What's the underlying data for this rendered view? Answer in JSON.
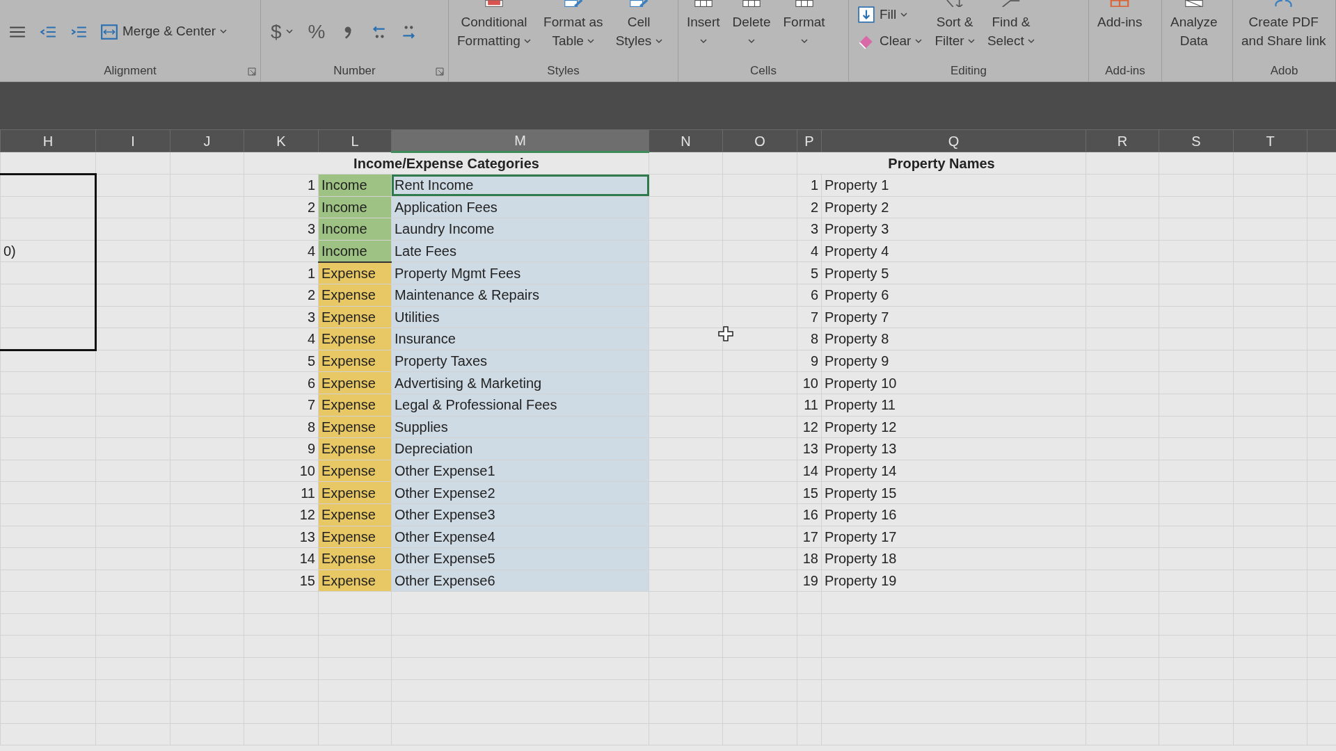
{
  "ribbon": {
    "groups": [
      {
        "label": "Alignment",
        "launcher": true,
        "items": [
          {
            "kind": "icon"
          },
          {
            "kind": "icon"
          },
          {
            "kind": "icon"
          },
          {
            "kind": "small",
            "label": "Merge & Center",
            "dropdown": true
          }
        ]
      },
      {
        "label": "Number",
        "launcher": true,
        "items": [
          {
            "kind": "symbol",
            "label": "$",
            "dropdown": true
          },
          {
            "kind": "symbol",
            "label": "%"
          },
          {
            "kind": "icon"
          },
          {
            "kind": "icon"
          },
          {
            "kind": "icon"
          }
        ]
      },
      {
        "label": "Styles",
        "items": [
          {
            "kind": "large",
            "lines": [
              "Conditional",
              "Formatting"
            ],
            "dropdown": true
          },
          {
            "kind": "large",
            "lines": [
              "Format as",
              "Table"
            ],
            "dropdown": true
          },
          {
            "kind": "large",
            "lines": [
              "Cell",
              "Styles"
            ],
            "dropdown": true
          }
        ]
      },
      {
        "label": "Cells",
        "items": [
          {
            "kind": "large",
            "lines": [
              "Insert"
            ],
            "dropdown": true
          },
          {
            "kind": "large",
            "lines": [
              "Delete"
            ],
            "dropdown": true
          },
          {
            "kind": "large",
            "lines": [
              "Format"
            ],
            "dropdown": true
          }
        ]
      },
      {
        "label": "Editing",
        "items": [
          {
            "kind": "stack",
            "items": [
              {
                "kind": "small",
                "label": "Fill",
                "dropdown": true
              },
              {
                "kind": "small",
                "label": "Clear",
                "dropdown": true
              }
            ]
          },
          {
            "kind": "large",
            "lines": [
              "Sort &",
              "Filter"
            ],
            "dropdown": true
          },
          {
            "kind": "large",
            "lines": [
              "Find &",
              "Select"
            ],
            "dropdown": true
          }
        ]
      },
      {
        "label": "Add-ins",
        "items": [
          {
            "kind": "large",
            "lines": [
              "Add-ins"
            ]
          }
        ]
      },
      {
        "items": [
          {
            "kind": "large",
            "lines": [
              "Analyze",
              "Data"
            ]
          }
        ]
      },
      {
        "label": "Adob",
        "items": [
          {
            "kind": "large",
            "lines": [
              "Create PDF",
              "and Share link"
            ]
          }
        ]
      }
    ]
  },
  "columns": [
    {
      "label": "H",
      "selected": false
    },
    {
      "label": "I",
      "selected": false
    },
    {
      "label": "J",
      "selected": false
    },
    {
      "label": "K",
      "selected": false
    },
    {
      "label": "L",
      "selected": false
    },
    {
      "label": "M",
      "selected": true
    },
    {
      "label": "N",
      "selected": false
    },
    {
      "label": "O",
      "selected": false
    },
    {
      "label": "P",
      "selected": false
    },
    {
      "label": "Q",
      "selected": false
    },
    {
      "label": "R",
      "selected": false
    },
    {
      "label": "S",
      "selected": false
    },
    {
      "label": "T",
      "selected": false
    }
  ],
  "categories": {
    "title": "Income/Expense Categories",
    "rows": [
      {
        "number": "1",
        "kind": "income",
        "type": "Income",
        "name": "Rent Income",
        "selected": true
      },
      {
        "number": "2",
        "kind": "income",
        "type": "Income",
        "name": "Application Fees",
        "selected": false
      },
      {
        "number": "3",
        "kind": "income",
        "type": "Income",
        "name": "Laundry Income",
        "selected": false
      },
      {
        "number": "4",
        "kind": "income",
        "type": "Income",
        "name": "Late Fees",
        "selected": false
      },
      {
        "number": "1",
        "kind": "expense",
        "type": "Expense",
        "name": "Property Mgmt Fees",
        "selected": false
      },
      {
        "number": "2",
        "kind": "expense",
        "type": "Expense",
        "name": "Maintenance & Repairs",
        "selected": false
      },
      {
        "number": "3",
        "kind": "expense",
        "type": "Expense",
        "name": "Utilities",
        "selected": false
      },
      {
        "number": "4",
        "kind": "expense",
        "type": "Expense",
        "name": "Insurance",
        "selected": false
      },
      {
        "number": "5",
        "kind": "expense",
        "type": "Expense",
        "name": "Property Taxes",
        "selected": false
      },
      {
        "number": "6",
        "kind": "expense",
        "type": "Expense",
        "name": "Advertising & Marketing",
        "selected": false
      },
      {
        "number": "7",
        "kind": "expense",
        "type": "Expense",
        "name": "Legal & Professional Fees",
        "selected": false
      },
      {
        "number": "8",
        "kind": "expense",
        "type": "Expense",
        "name": "Supplies",
        "selected": false
      },
      {
        "number": "9",
        "kind": "expense",
        "type": "Expense",
        "name": "Depreciation",
        "selected": false
      },
      {
        "number": "10",
        "kind": "expense",
        "type": "Expense",
        "name": "Other Expense1",
        "selected": false
      },
      {
        "number": "11",
        "kind": "expense",
        "type": "Expense",
        "name": "Other Expense2",
        "selected": false
      },
      {
        "number": "12",
        "kind": "expense",
        "type": "Expense",
        "name": "Other Expense3",
        "selected": false
      },
      {
        "number": "13",
        "kind": "expense",
        "type": "Expense",
        "name": "Other Expense4",
        "selected": false
      },
      {
        "number": "14",
        "kind": "expense",
        "type": "Expense",
        "name": "Other Expense5",
        "selected": false
      },
      {
        "number": "15",
        "kind": "expense",
        "type": "Expense",
        "name": "Other Expense6",
        "selected": false
      }
    ]
  },
  "left_box": {
    "rows": [
      {
        "boxed": true
      },
      {
        "boxed": true
      },
      {
        "boxed": true
      },
      {
        "boxed": true,
        "text": "0)"
      },
      {
        "boxed": true
      },
      {
        "boxed": true
      },
      {
        "boxed": true
      },
      {
        "boxed": true
      }
    ]
  },
  "properties": {
    "title": "Property Names",
    "rows": [
      {
        "number": "1",
        "name": "Property 1"
      },
      {
        "number": "2",
        "name": "Property 2"
      },
      {
        "number": "3",
        "name": "Property 3"
      },
      {
        "number": "4",
        "name": "Property 4"
      },
      {
        "number": "5",
        "name": "Property 5"
      },
      {
        "number": "6",
        "name": "Property 6"
      },
      {
        "number": "7",
        "name": "Property 7"
      },
      {
        "number": "8",
        "name": "Property 8"
      },
      {
        "number": "9",
        "name": "Property 9"
      },
      {
        "number": "10",
        "name": "Property 10"
      },
      {
        "number": "11",
        "name": "Property 11"
      },
      {
        "number": "12",
        "name": "Property 12"
      },
      {
        "number": "13",
        "name": "Property 13"
      },
      {
        "number": "14",
        "name": "Property 14"
      },
      {
        "number": "15",
        "name": "Property 15"
      },
      {
        "number": "16",
        "name": "Property 16"
      },
      {
        "number": "17",
        "name": "Property 17"
      },
      {
        "number": "18",
        "name": "Property 18"
      },
      {
        "number": "19",
        "name": "Property 19"
      }
    ]
  }
}
